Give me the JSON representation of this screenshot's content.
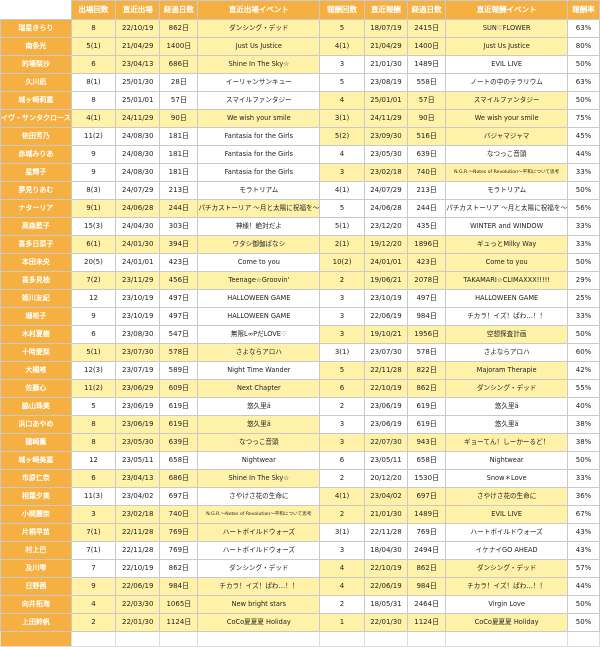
{
  "header": {
    "corner": "",
    "appearance_count": "出場回数",
    "recent_appearance": "直近出場",
    "days_elapsed_1": "経過日数",
    "recent_appearance_event": "直近出場イベント",
    "reward_count": "報酬回数",
    "recent_reward": "直近報酬",
    "days_elapsed_2": "経過日数",
    "recent_reward_event": "直近報酬イベント",
    "reward_rate": "報酬率"
  },
  "rows": [
    {
      "name": "瑞星きらり",
      "count": "8",
      "date": "22/10/19",
      "days": "862日",
      "event": "ダンシング・デッド",
      "rcount": "5",
      "rdate": "18/07/19",
      "rdays": "2415日",
      "revent": "SUN♡FLOWER",
      "rate": "63%"
    },
    {
      "name": "南条光",
      "count": "5(1)",
      "date": "21/04/29",
      "days": "1400日",
      "event": "Just Us Justice",
      "rcount": "4(1)",
      "rdate": "21/04/29",
      "rdays": "1400日",
      "revent": "Just Us Justice",
      "rate": "80%"
    },
    {
      "name": "的場梨沙",
      "count": "6",
      "date": "23/04/13",
      "days": "686日",
      "event": "Shine In The Sky☆",
      "rcount": "3",
      "rdate": "21/01/30",
      "rdays": "1489日",
      "revent": "EVIL LIVE",
      "rate": "50%"
    },
    {
      "name": "久川凪",
      "count": "8(1)",
      "date": "25/01/30",
      "days": "28日",
      "event": "イーリャンサンキュー",
      "rcount": "5",
      "rdate": "23/08/19",
      "rdays": "558日",
      "revent": "ノートの中のテラリウム",
      "rate": "63%"
    },
    {
      "name": "城ヶ崎莉嘉",
      "count": "8",
      "date": "25/01/01",
      "days": "57日",
      "event": "スマイルファンタジー",
      "rcount": "4",
      "rdate": "25/01/01",
      "rdays": "57日",
      "revent": "スマイルファンタジー",
      "rate": "50%"
    },
    {
      "name": "イヴ・サンタクロース",
      "count": "4(1)",
      "date": "24/11/29",
      "days": "90日",
      "event": "We wish your smile",
      "rcount": "3(1)",
      "rdate": "24/11/29",
      "rdays": "90日",
      "revent": "We wish your smile",
      "rate": "75%"
    },
    {
      "name": "依田芳乃",
      "count": "11(2)",
      "date": "24/08/30",
      "days": "181日",
      "event": "Fantasia for the Girls",
      "rcount": "5(2)",
      "rdate": "23/09/30",
      "rdays": "516日",
      "revent": "バジャマジャマ",
      "rate": "45%"
    },
    {
      "name": "赤城みりあ",
      "count": "9",
      "date": "24/08/30",
      "days": "181日",
      "event": "Fantasia for the Girls",
      "rcount": "4",
      "rdate": "23/05/30",
      "rdays": "639日",
      "revent": "なつっこ音頭",
      "rate": "44%"
    },
    {
      "name": "星輝子",
      "count": "9",
      "date": "24/08/30",
      "days": "181日",
      "event": "Fantasia for the Girls",
      "rcount": "3",
      "rdate": "23/02/18",
      "rdays": "740日",
      "revent": "N.G.R.～Notes of Revolution～平和について思考",
      "rate": "33%"
    },
    {
      "name": "夢見りあむ",
      "count": "8(3)",
      "date": "24/07/29",
      "days": "213日",
      "event": "モラトリアム",
      "rcount": "4(1)",
      "rdate": "24/07/29",
      "rdays": "213日",
      "revent": "モラトリアム",
      "rate": "50%"
    },
    {
      "name": "ナターリア",
      "count": "9(1)",
      "date": "24/06/28",
      "days": "244日",
      "event": "パチカストーリア ～月と太陽に祝福を～",
      "rcount": "5",
      "rdate": "24/06/28",
      "rdays": "244日",
      "revent": "パチカストーリア ～月と太陽に祝福を～",
      "rate": "56%"
    },
    {
      "name": "高森藍子",
      "count": "15(3)",
      "date": "24/04/30",
      "days": "303日",
      "event": "神様！絶対だよ",
      "rcount": "5(1)",
      "rdate": "23/12/20",
      "rdays": "435日",
      "revent": "WINTER and WINDOW",
      "rate": "33%"
    },
    {
      "name": "喜多日菜子",
      "count": "6(1)",
      "date": "24/01/30",
      "days": "394日",
      "event": "ワタシ御伽ばなシ",
      "rcount": "2(1)",
      "rdate": "19/12/20",
      "rdays": "1896日",
      "revent": "ギュっとMilky Way",
      "rate": "33%"
    },
    {
      "name": "本田未央",
      "count": "20(5)",
      "date": "24/01/01",
      "days": "423日",
      "event": "Come to you",
      "rcount": "10(2)",
      "rdate": "24/01/01",
      "rdays": "423日",
      "revent": "Come to you",
      "rate": "50%"
    },
    {
      "name": "喜多見柚",
      "count": "7(2)",
      "date": "23/11/29",
      "days": "456日",
      "event": "Teenage☆Groovin'",
      "rcount": "2",
      "rdate": "19/06/21",
      "rdays": "2078日",
      "revent": "TAKAMARI☆CLIMAXXX!!!!!",
      "rate": "29%"
    },
    {
      "name": "姫川友紀",
      "count": "12",
      "date": "23/10/19",
      "days": "497日",
      "event": "HALLOWEEN GAME",
      "rcount": "3",
      "rdate": "23/10/19",
      "rdays": "497日",
      "revent": "HALLOWEEN GAME",
      "rate": "25%"
    },
    {
      "name": "堀裕子",
      "count": "9",
      "date": "23/10/19",
      "days": "497日",
      "event": "HALLOWEEN GAME",
      "rcount": "3",
      "rdate": "22/06/19",
      "rdays": "984日",
      "revent": "チカラ！イズ！ぱわ…！！",
      "rate": "33%"
    },
    {
      "name": "木村夏樹",
      "count": "6",
      "date": "23/08/30",
      "days": "547日",
      "event": "無限L∞PだLOVE♡",
      "rcount": "3",
      "rdate": "19/10/21",
      "rdays": "1956日",
      "revent": "空想探査計画",
      "rate": "50%"
    },
    {
      "name": "十時愛梨",
      "count": "5(1)",
      "date": "23/07/30",
      "days": "578日",
      "event": "さよならアロハ",
      "rcount": "3(1)",
      "rdate": "23/07/30",
      "rdays": "578日",
      "revent": "さよならアロハ",
      "rate": "60%"
    },
    {
      "name": "大槻唯",
      "count": "12(3)",
      "date": "23/07/19",
      "days": "589日",
      "event": "Night Time Wander",
      "rcount": "5",
      "rdate": "22/11/28",
      "rdays": "822日",
      "revent": "Majoram Therapie",
      "rate": "42%"
    },
    {
      "name": "佐藤心",
      "count": "11(2)",
      "date": "23/06/29",
      "days": "609日",
      "event": "Next Chapter",
      "rcount": "6",
      "rdate": "22/10/19",
      "rdays": "862日",
      "revent": "ダンシング・デッド",
      "rate": "55%"
    },
    {
      "name": "脇山珠美",
      "count": "5",
      "date": "23/06/19",
      "days": "619日",
      "event": "悠久里ä",
      "rcount": "2",
      "rdate": "23/06/19",
      "rdays": "619日",
      "revent": "悠久里ä",
      "rate": "40%"
    },
    {
      "name": "浜口あやめ",
      "count": "8",
      "date": "23/06/19",
      "days": "619日",
      "event": "悠久里ä",
      "rcount": "3",
      "rdate": "23/06/19",
      "rdays": "619日",
      "revent": "悠久里ä",
      "rate": "38%"
    },
    {
      "name": "龍崎薫",
      "count": "8",
      "date": "23/05/30",
      "days": "639日",
      "event": "なつっこ音頭",
      "rcount": "3",
      "rdate": "22/07/30",
      "rdays": "943日",
      "revent": "ギョーてん！しーかーるど！",
      "rate": "38%"
    },
    {
      "name": "城ヶ崎美嘉",
      "count": "12",
      "date": "23/05/11",
      "days": "658日",
      "event": "Nightwear",
      "rcount": "6",
      "rdate": "23/05/11",
      "rdays": "658日",
      "revent": "Nightwear",
      "rate": "50%"
    },
    {
      "name": "市原仁奈",
      "count": "6",
      "date": "23/04/13",
      "days": "686日",
      "event": "Shine In The Sky☆",
      "rcount": "2",
      "rdate": "20/12/20",
      "rdays": "1530日",
      "revent": "Snow＊Love",
      "rate": "33%"
    },
    {
      "name": "相葉夕美",
      "count": "11(3)",
      "date": "23/04/02",
      "days": "697日",
      "event": "さやけさ花の生命に",
      "rcount": "4(1)",
      "rdate": "23/04/02",
      "rdays": "697日",
      "revent": "さやけさ花の生命に",
      "rate": "36%"
    },
    {
      "name": "小関麗奈",
      "count": "3",
      "date": "23/02/18",
      "days": "740日",
      "event": "N.G.R.～Notes of Revolution～平和について思考",
      "rcount": "2",
      "rdate": "21/01/30",
      "rdays": "1489日",
      "revent": "EVIL LIVE",
      "rate": "67%"
    },
    {
      "name": "片桐早苗",
      "count": "7(1)",
      "date": "22/11/28",
      "days": "769日",
      "event": "ハートボイルドウォーズ",
      "rcount": "3(1)",
      "rdate": "22/11/28",
      "rdays": "769日",
      "revent": "ハートボイルドウォーズ",
      "rate": "43%"
    },
    {
      "name": "村上巴",
      "count": "7(1)",
      "date": "22/11/28",
      "days": "769日",
      "event": "ハートボイルドウォーズ",
      "rcount": "3",
      "rdate": "18/04/30",
      "rdays": "2494日",
      "revent": "イケナイGO AHEAD",
      "rate": "43%"
    },
    {
      "name": "及川雫",
      "count": "7",
      "date": "22/10/19",
      "days": "862日",
      "event": "ダンシング・デッド",
      "rcount": "4",
      "rdate": "22/10/19",
      "rdays": "862日",
      "revent": "ダンシング・デッド",
      "rate": "57%"
    },
    {
      "name": "日野茜",
      "count": "9",
      "date": "22/06/19",
      "days": "984日",
      "event": "チカラ！イズ！ぱわ…！！",
      "rcount": "4",
      "rdate": "22/06/19",
      "rdays": "984日",
      "revent": "チカラ！イズ！ぱわ…！！",
      "rate": "44%"
    },
    {
      "name": "向井拓海",
      "count": "4",
      "date": "22/03/30",
      "days": "1065日",
      "event": "New bright stars",
      "rcount": "2",
      "rdate": "18/05/31",
      "rdays": "2464日",
      "revent": "Virgin Love",
      "rate": "50%"
    },
    {
      "name": "上田鈴帆",
      "count": "2",
      "date": "22/01/30",
      "days": "1124日",
      "event": "CoCo夏夏夏 Holiday",
      "rcount": "1",
      "rdate": "22/01/30",
      "rdays": "1124日",
      "revent": "CoCo夏夏夏 Holiday",
      "rate": "50%"
    }
  ],
  "column_colors": {
    "header": "#f5b041",
    "name_column": "#f5b041",
    "highlight": "#fff2a8",
    "plain": "#ffffff"
  }
}
